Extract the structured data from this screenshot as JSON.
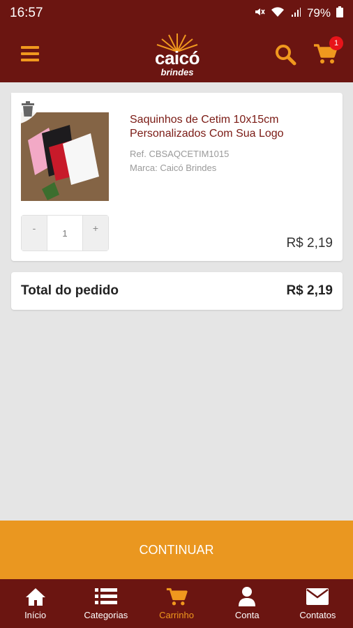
{
  "status_bar": {
    "time": "16:57",
    "battery": "79%"
  },
  "header": {
    "logo_main": "caicó",
    "logo_sub": "brindes",
    "cart_count": "1"
  },
  "product": {
    "name": "Saquinhos de Cetim 10x15cm Personalizados Com Sua Logo",
    "ref": "Ref. CBSAQCETIM1015",
    "brand": "Marca: Caicó Brindes",
    "qty_minus": "-",
    "qty_value": "1",
    "qty_plus": "+",
    "price": "R$ 2,19"
  },
  "total": {
    "label": "Total do pedido",
    "value": "R$ 2,19"
  },
  "continue_label": "CONTINUAR",
  "nav": [
    {
      "label": "Início",
      "icon": "home-icon"
    },
    {
      "label": "Categorias",
      "icon": "list-icon"
    },
    {
      "label": "Carrinho",
      "icon": "cart-icon"
    },
    {
      "label": "Conta",
      "icon": "user-icon"
    },
    {
      "label": "Contatos",
      "icon": "envelope-icon"
    }
  ],
  "colors": {
    "primary": "#6b1511",
    "accent": "#f0981e",
    "button": "#ea9720",
    "badge": "#e8141a"
  }
}
